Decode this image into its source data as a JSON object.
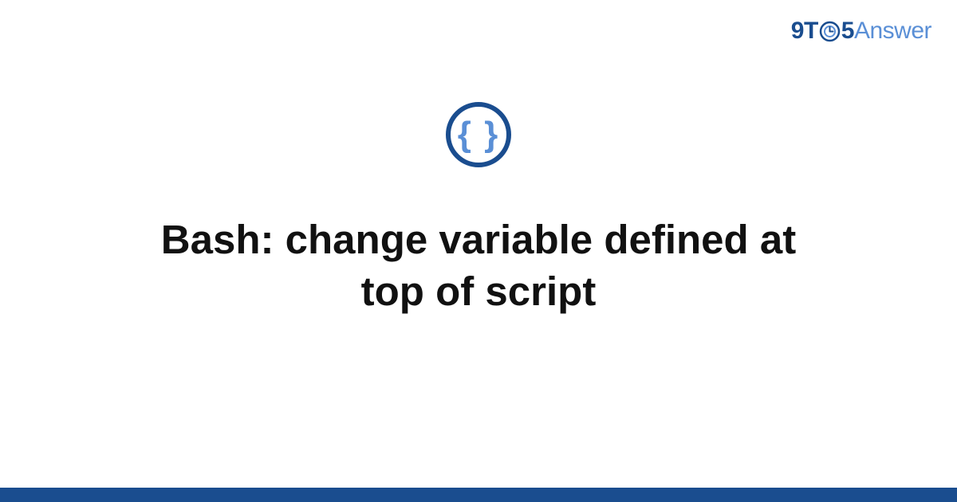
{
  "brand": {
    "part1": "9",
    "part2": "T",
    "part3": "5",
    "part4": "Answer"
  },
  "icon": {
    "braces": "{ }"
  },
  "main": {
    "title": "Bash: change variable defined at top of script"
  },
  "colors": {
    "primary": "#1a4d8f",
    "secondary": "#5a8fd6",
    "text": "#111111",
    "background": "#ffffff"
  }
}
